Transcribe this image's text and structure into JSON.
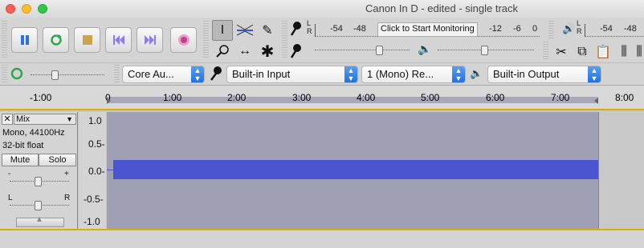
{
  "window": {
    "title": "Canon In D - edited - single track"
  },
  "colors": {
    "waveform": "#4a54d0",
    "selection_bg": "#a0a0b4",
    "selection_border": "#d8b000"
  },
  "transport": {
    "pause": "pause-icon",
    "loop": "loop-icon",
    "stop": "stop-icon",
    "skip_start": "skip-to-start-icon",
    "skip_end": "skip-to-end-icon",
    "record": "record-icon"
  },
  "meters": {
    "record_scale": [
      "-54",
      "-48",
      "-12",
      "-6",
      "0"
    ],
    "monitor_prompt": "Click to Start Monitoring",
    "playback_scale": [
      "-54",
      "-48"
    ],
    "record_lr": "L R",
    "playback_lr": "L R"
  },
  "devices": {
    "host": "Core Au...",
    "input": "Built-in Input",
    "channels": "1 (Mono) Re...",
    "output": "Built-in Output"
  },
  "ruler": [
    "-1:00",
    "0",
    "1:00",
    "2:00",
    "3:00",
    "4:00",
    "5:00",
    "6:00",
    "7:00",
    "8:00"
  ],
  "track": {
    "name": "Mix",
    "format": "Mono, 44100Hz",
    "bitdepth": "32-bit float",
    "mute": "Mute",
    "solo": "Solo",
    "pan_left": "L",
    "pan_right": "R",
    "gain_minus": "-",
    "gain_plus": "+",
    "scale": [
      "1.0",
      "0.5-",
      "0.0-",
      "-0.5-",
      "-1.0"
    ]
  }
}
